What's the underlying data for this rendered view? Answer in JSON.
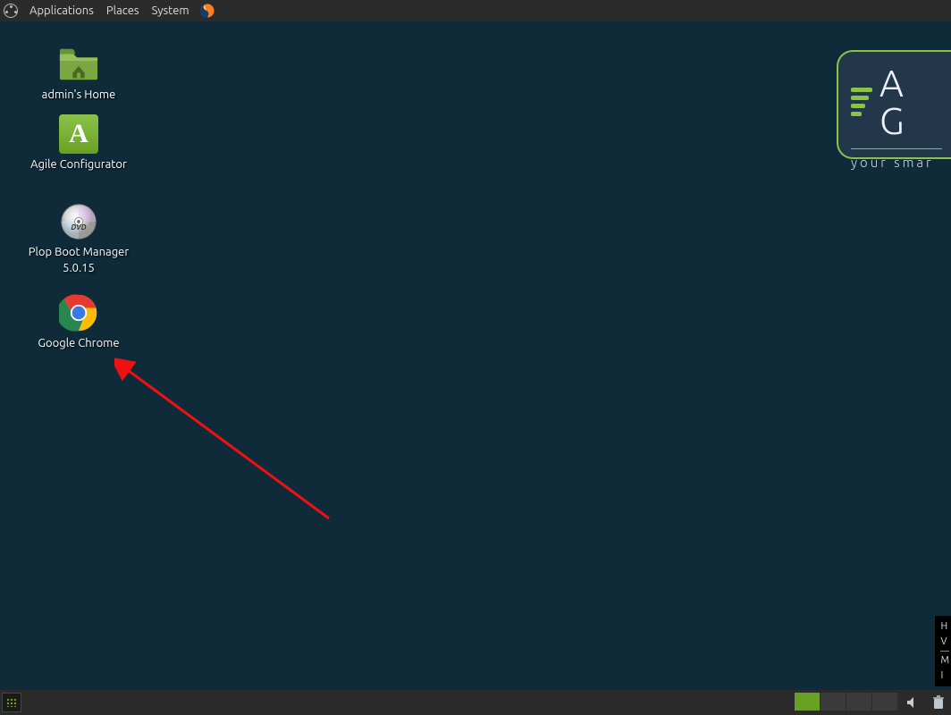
{
  "topbar": {
    "menus": [
      "Applications",
      "Places",
      "System"
    ]
  },
  "desktop_icons": [
    {
      "label": "admin's Home"
    },
    {
      "label": "Agile Configurator"
    },
    {
      "label": "Plop Boot Manager 5.0.15"
    },
    {
      "label": "Google Chrome"
    }
  ],
  "brand": {
    "letters": "A G",
    "tagline": "your smar"
  },
  "info_stub": {
    "lines_top": [
      "H",
      "V"
    ],
    "lines_bottom": [
      "M",
      "I"
    ]
  },
  "workspaces": {
    "count": 4,
    "active": 0
  }
}
